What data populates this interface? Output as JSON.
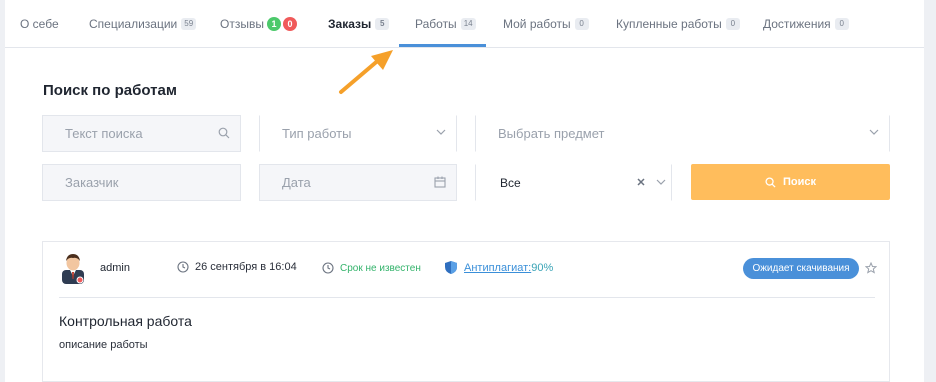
{
  "tabs": [
    {
      "label": "О себе",
      "badge": ""
    },
    {
      "label": "Специализации",
      "badge": "59"
    },
    {
      "label": "Отзывы",
      "badge_green": "1",
      "badge_red": "0"
    },
    {
      "label": "Заказы",
      "badge": "5"
    },
    {
      "label": "Работы",
      "badge": "14"
    },
    {
      "label": "Мой работы",
      "badge": "0"
    },
    {
      "label": "Купленные работы",
      "badge": "0"
    },
    {
      "label": "Достижения",
      "badge": "0"
    }
  ],
  "search": {
    "title": "Поиск по работам",
    "text_placeholder": "Текст поиска",
    "type_placeholder": "Тип работы",
    "subject_placeholder": "Выбрать предмет",
    "customer_placeholder": "Заказчик",
    "date_placeholder": "Дата",
    "filter_value": "Все",
    "button_label": "Поиск"
  },
  "card": {
    "author": "admin",
    "date": "26 сентября в 16:04",
    "deadline": "Срок не известен",
    "plagiarism_label": "Антиплагиат:",
    "plagiarism_value": " 90%",
    "status": "Ожидает скачивания",
    "title": "Контрольная работа",
    "description": "описание работы"
  },
  "colors": {
    "accent": "#4a90d9",
    "search_button": "#ffbd5c",
    "arrow": "#f5a02a",
    "green": "#33b36b"
  }
}
